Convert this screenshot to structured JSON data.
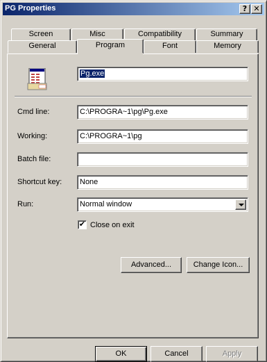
{
  "window": {
    "title": "PG Properties"
  },
  "titlebar_buttons": {
    "help": "?",
    "close": "✕"
  },
  "tabs_back": [
    {
      "label": "Screen"
    },
    {
      "label": "Misc"
    },
    {
      "label": "Compatibility"
    },
    {
      "label": "Summary"
    }
  ],
  "tabs_front": [
    {
      "label": "General"
    },
    {
      "label": "Program",
      "active": true
    },
    {
      "label": "Font"
    },
    {
      "label": "Memory"
    }
  ],
  "program": {
    "name_value": "Pg.exe",
    "cmd_line_label": "Cmd line:",
    "cmd_line_value": "C:\\PROGRA~1\\pg\\Pg.exe",
    "working_label": "Working:",
    "working_value": "C:\\PROGRA~1\\pg",
    "batch_file_label": "Batch file:",
    "batch_file_value": "",
    "shortcut_key_label": "Shortcut key:",
    "shortcut_key_value": "None",
    "run_label": "Run:",
    "run_value": "Normal window",
    "close_on_exit_label": "Close on exit",
    "close_on_exit_checked": true,
    "advanced_button": "Advanced...",
    "change_icon_button": "Change Icon..."
  },
  "footer": {
    "ok": "OK",
    "cancel": "Cancel",
    "apply": "Apply"
  },
  "colors": {
    "titlebar_start": "#0a246a",
    "titlebar_end": "#a6caf0",
    "face": "#d4d0c8",
    "selection": "#0a246a"
  }
}
